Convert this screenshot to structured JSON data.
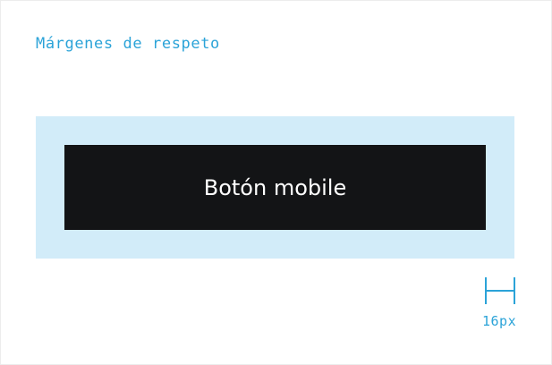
{
  "title": "Márgenes de respeto",
  "button": {
    "label": "Botón mobile"
  },
  "measure": {
    "label": "16px",
    "icon": "width-measure-icon"
  },
  "colors": {
    "accent": "#2ba3d8",
    "margin_zone": "#d2ecf9",
    "button_bg": "#131416",
    "button_text": "#ffffff"
  }
}
